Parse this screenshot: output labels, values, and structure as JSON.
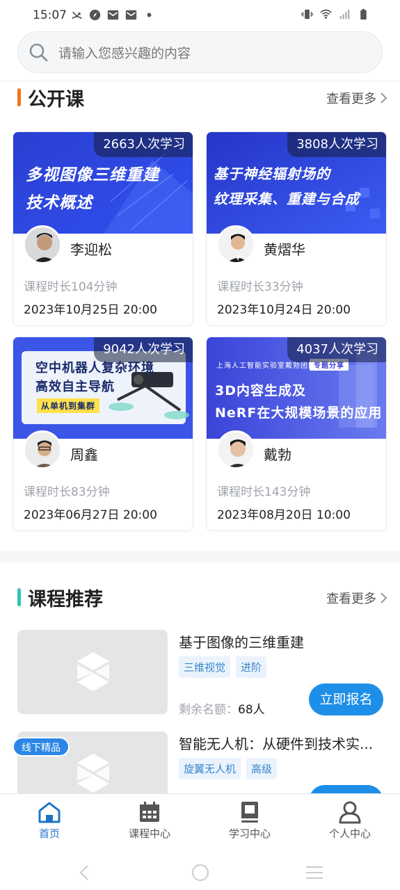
{
  "status_bar": {
    "time": "15:07",
    "left_icons": [
      "missed-call-icon",
      "compass-icon",
      "mail-icon",
      "mail-icon",
      "dot-icon"
    ],
    "right_icons": [
      "vibrate-icon",
      "wifi-icon",
      "signal-icon",
      "battery-icon"
    ]
  },
  "search": {
    "placeholder": "请输入您感兴趣的内容",
    "icon": "search-icon"
  },
  "open_courses": {
    "title": "公开课",
    "more": "查看更多",
    "accent_color": "#f0731a",
    "cards": [
      {
        "study_count": "2663人次学习",
        "banner_lines": [
          "多视图像三维重建",
          "技术概述"
        ],
        "teacher": "李迎松",
        "duration": "课程时长104分钟",
        "datetime": "2023年10月25日 20:00"
      },
      {
        "study_count": "3808人次学习",
        "banner_lines": [
          "基于神经辐射场的",
          "纹理采集、重建与合成"
        ],
        "teacher": "黄熠华",
        "duration": "课程时长33分钟",
        "datetime": "2023年10月24日 20:00"
      },
      {
        "study_count": "9042人次学习",
        "banner_lines": [
          "空中机器人复杂环境",
          "高效自主导航",
          "从单机到集群"
        ],
        "teacher": "周鑫",
        "duration": "课程时长83分钟",
        "datetime": "2023年06月27日 20:00"
      },
      {
        "study_count": "4037人次学习",
        "banner_lines": [
          "上海人工智能实验室戴勃团队",
          "专题分享",
          "3D内容生成及",
          "NeRF在大规模场景的应用"
        ],
        "teacher": "戴勃",
        "duration": "课程时长143分钟",
        "datetime": "2023年08月20日 10:00"
      }
    ]
  },
  "recommend": {
    "title": "课程推荐",
    "more": "查看更多",
    "accent_color": "#2ec4b6",
    "items": [
      {
        "title": "基于图像的三维重建",
        "tags": [
          "三维视觉",
          "进阶"
        ],
        "quota_label": "剩余名额：",
        "quota_value": "68人",
        "button": "立即报名"
      },
      {
        "badge": "线下精品",
        "title": "智能无人机：从硬件到技术实...",
        "tags": [
          "旋翼无人机",
          "高级"
        ]
      }
    ]
  },
  "bottom_nav": {
    "items": [
      {
        "label": "首页",
        "icon": "home-icon",
        "active": true
      },
      {
        "label": "课程中心",
        "icon": "calendar-icon",
        "active": false
      },
      {
        "label": "学习中心",
        "icon": "book-icon",
        "active": false
      },
      {
        "label": "个人中心",
        "icon": "user-icon",
        "active": false
      }
    ],
    "active_color": "#1e73c8"
  }
}
